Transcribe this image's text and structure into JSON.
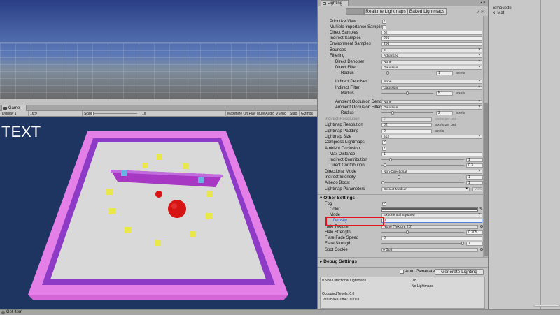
{
  "game_view": {
    "tab_label": "Game",
    "display": "Display 1",
    "aspect": "16:9",
    "scale_label": "Scale",
    "scale_value": "1x",
    "toolbar_buttons": [
      "Maximize On Play",
      "Mute Audio",
      "VSync",
      "Stats",
      "Gizmos"
    ],
    "overlay_text": "TEXT"
  },
  "lighting": {
    "window_title": "Lighting",
    "tabs": [
      "Scene",
      "Realtime Lightmaps",
      "Baked Lightmaps"
    ],
    "active_tab": "Scene",
    "lightmapper_rows": {
      "prioritize_view": "Prioritize View",
      "multiple_importance_sampling": "Multiple Importance Sampling",
      "direct_samples": {
        "label": "Direct Samples",
        "value": "32"
      },
      "indirect_samples": {
        "label": "Indirect Samples",
        "value": "256"
      },
      "environment_samples": {
        "label": "Environment Samples",
        "value": "256"
      },
      "bounces": {
        "label": "Bounces",
        "value": "2"
      },
      "filtering": {
        "label": "Filtering",
        "value": "Advanced"
      },
      "direct_denoiser": {
        "label": "Direct Denoiser",
        "value": "None"
      },
      "direct_filter": {
        "label": "Direct Filter",
        "value": "Gaussian"
      },
      "direct_radius": {
        "label": "Radius",
        "value": "1",
        "unit": "texels",
        "fraction": 0.1
      },
      "indirect_denoiser": {
        "label": "Indirect Denoiser",
        "value": "None"
      },
      "indirect_filter": {
        "label": "Indirect Filter",
        "value": "Gaussian"
      },
      "indirect_radius": {
        "label": "Radius",
        "value": "5",
        "unit": "texels",
        "fraction": 0.5
      },
      "ao_denoiser": {
        "label": "Ambient Occlusion Denois",
        "value": "None"
      },
      "ao_filter": {
        "label": "Ambient Occlusion Filter",
        "value": "Gaussian"
      },
      "ao_radius": {
        "label": "Radius",
        "value": "2",
        "unit": "texels",
        "fraction": 0.2
      },
      "indirect_resolution": {
        "label": "Indirect Resolution",
        "value": "2",
        "unit": "texels per unit"
      },
      "lightmap_resolution": {
        "label": "Lightmap Resolution",
        "value": "32",
        "unit": "texels per unit"
      },
      "lightmap_padding": {
        "label": "Lightmap Padding",
        "value": "2",
        "unit": "texels"
      },
      "lightmap_size": {
        "label": "Lightmap Size",
        "value": "512"
      },
      "compress_lightmaps": "Compress Lightmaps",
      "ambient_occlusion": "Ambient Occlusion",
      "max_distance": {
        "label": "Max Distance",
        "value": "1"
      },
      "indirect_contribution": {
        "label": "Indirect Contribution",
        "value": "1",
        "fraction": 0.1
      },
      "direct_contribution": {
        "label": "Direct Contribution",
        "value": "0.3",
        "fraction": 0.03
      },
      "directional_mode": {
        "label": "Directional Mode",
        "value": "Non-Directional"
      },
      "indirect_intensity": {
        "label": "Indirect Intensity",
        "value": "1",
        "fraction": 0.2
      },
      "albedo_boost": {
        "label": "Albedo Boost",
        "value": "1",
        "fraction": 0.0
      },
      "lightmap_parameters": {
        "label": "Lightmap Parameters",
        "value": "Default-Medium",
        "button": "View"
      }
    },
    "other_settings": {
      "title": "Other Settings",
      "fog": "Fog",
      "color": "Color",
      "mode": {
        "label": "Mode",
        "value": "Exponential Squared"
      },
      "density": {
        "label": "Density",
        "value": "0"
      },
      "halo_texture": {
        "label": "Halo Texture",
        "value": "None (Texture 2D)"
      },
      "halo_strength": {
        "label": "Halo Strength",
        "value": "0.305",
        "fraction": 0.305
      },
      "flare_fade_speed": {
        "label": "Flare Fade Speed",
        "value": "3"
      },
      "flare_strength": {
        "label": "Flare Strength",
        "value": "1",
        "fraction": 1.0
      },
      "spot_cookie": {
        "label": "Spot Cookie",
        "value": "Soft"
      }
    },
    "debug_settings": {
      "title": "Debug Settings"
    },
    "footer": {
      "auto_generate": "Auto Generate",
      "generate_button": "Generate Lighting",
      "stats_lightmaps": "0 Non-Directional Lightmaps",
      "stats_size": "0 B",
      "stats_no_lightmaps": "No Lightmaps",
      "occupied_texels": "Occupied Texels: 0.0",
      "bake_time": "Total Bake Time: 0:00:00"
    }
  },
  "right_panel": {
    "items": [
      "Silhouette",
      "x_Mat"
    ]
  },
  "status": {
    "text": "Get Item"
  },
  "colors": {
    "game_background": "#1d3560",
    "wall_outer": "#e37fe6",
    "wall_inner": "#8d3bc7",
    "floor": "#d9d9d9",
    "cube": "#e8e84a",
    "sphere": "#d61414",
    "highlight": "#e8121f"
  }
}
